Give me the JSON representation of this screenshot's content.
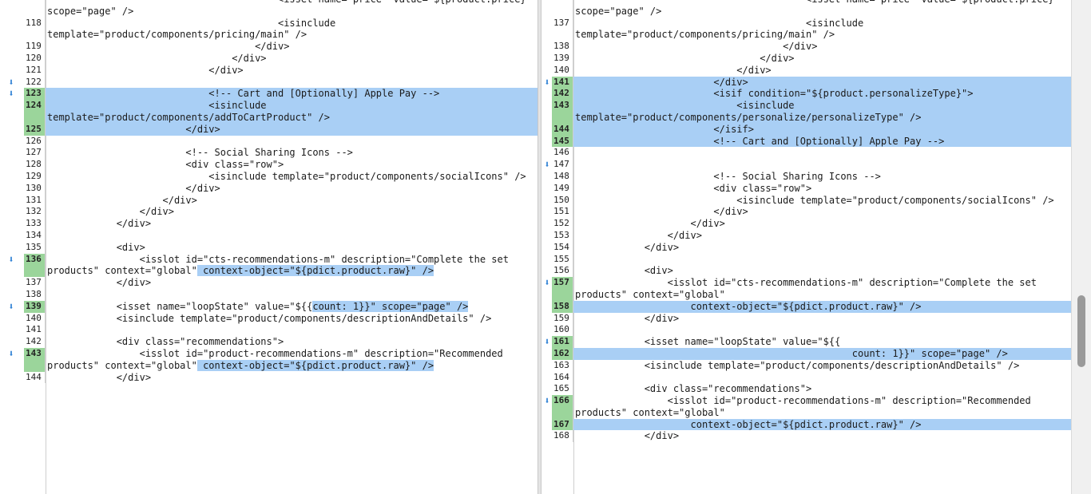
{
  "left": {
    "rows": [
      {
        "n": "",
        "t": "                                        <isset name=\"price\" value=\"${product.price}\""
      },
      {
        "n": "",
        "t": "scope=\"page\" />"
      },
      {
        "n": "118",
        "t": "                                        <isinclude"
      },
      {
        "n": "",
        "t": "template=\"product/components/pricing/main\" />"
      },
      {
        "n": "119",
        "t": "                                    </div>"
      },
      {
        "n": "120",
        "t": "                                </div>"
      },
      {
        "n": "121",
        "t": "                            </div>"
      },
      {
        "n": "",
        "t": "",
        "gap": true,
        "arrow": true
      },
      {
        "n": "",
        "t": "",
        "gap": true
      },
      {
        "n": "",
        "t": "",
        "gap": true
      },
      {
        "n": "",
        "t": "",
        "gap": true
      },
      {
        "n": "",
        "t": "",
        "gap": true
      },
      {
        "n": "",
        "t": "",
        "gap": true
      },
      {
        "n": "122",
        "t": ""
      },
      {
        "n": "123",
        "t": "                            <!-- Cart and [Optionally] Apple Pay -->",
        "hl": true,
        "arrow": true
      },
      {
        "n": "124",
        "t": "                            <isinclude",
        "hl": true
      },
      {
        "n": "",
        "t": "template=\"product/components/addToCartProduct\" />",
        "hl": true
      },
      {
        "n": "125",
        "t": "                        </div>",
        "hl": true
      },
      {
        "n": "126",
        "t": ""
      },
      {
        "n": "127",
        "t": "                        <!-- Social Sharing Icons -->"
      },
      {
        "n": "128",
        "t": "                        <div class=\"row\">"
      },
      {
        "n": "129",
        "t": "                            <isinclude template=\"product/components/socialIcons\" />"
      },
      {
        "n": "130",
        "t": "                        </div>"
      },
      {
        "n": "131",
        "t": "                    </div>"
      },
      {
        "n": "132",
        "t": "                </div>"
      },
      {
        "n": "133",
        "t": "            </div>"
      },
      {
        "n": "134",
        "t": ""
      },
      {
        "n": "135",
        "t": "            <div>"
      },
      {
        "n": "136",
        "t": "                <isslot id=\"cts-recommendations-m\" description=\"Complete the set",
        "chg": true,
        "arrow": true
      },
      {
        "n": "",
        "t": "products\" context=\"global\"",
        "hlpart": " context-object=\"${pdict.product.raw}\" />",
        "chg": true
      },
      {
        "n": "",
        "t": "",
        "blank": true
      },
      {
        "n": "137",
        "t": "            </div>"
      },
      {
        "n": "138",
        "t": ""
      },
      {
        "n": "139",
        "t": "            <isset name=\"loopState\" value=\"${{",
        "hlpart": "count: 1}}\" scope=\"page\" />",
        "chg": true,
        "arrow": true
      },
      {
        "n": "",
        "t": "",
        "blank": true
      },
      {
        "n": "140",
        "t": "            <isinclude template=\"product/components/descriptionAndDetails\" />"
      },
      {
        "n": "141",
        "t": ""
      },
      {
        "n": "142",
        "t": "            <div class=\"recommendations\">"
      },
      {
        "n": "143",
        "t": "                <isslot id=\"product-recommendations-m\" description=\"Recommended",
        "chg": true,
        "arrow": true
      },
      {
        "n": "",
        "t": "products\" context=\"global\"",
        "hlpart": " context-object=\"${pdict.product.raw}\" />",
        "chg": true
      },
      {
        "n": "",
        "t": "",
        "blank": true
      },
      {
        "n": "144",
        "t": "            </div>"
      }
    ]
  },
  "right": {
    "rows": [
      {
        "n": "",
        "t": "                                        <isset name=\"price\" value=\"${product.price}\""
      },
      {
        "n": "",
        "t": "scope=\"page\" />"
      },
      {
        "n": "137",
        "t": "                                        <isinclude"
      },
      {
        "n": "",
        "t": "template=\"product/components/pricing/main\" />"
      },
      {
        "n": "138",
        "t": "                                    </div>"
      },
      {
        "n": "139",
        "t": "                                </div>"
      },
      {
        "n": "140",
        "t": "                            </div>"
      },
      {
        "n": "141",
        "t": "                        </div>",
        "hl": true,
        "arrow": true
      },
      {
        "n": "142",
        "t": "                        <isif condition=\"${product.personalizeType}\">",
        "hl": true
      },
      {
        "n": "143",
        "t": "                            <isinclude",
        "hl": true
      },
      {
        "n": "",
        "t": "template=\"product/components/personalize/personalizeType\" />",
        "hl": true
      },
      {
        "n": "144",
        "t": "                        </isif>",
        "hl": true
      },
      {
        "n": "145",
        "t": "                        <!-- Cart and [Optionally] Apple Pay -->",
        "hl": true
      },
      {
        "n": "146",
        "t": ""
      },
      {
        "n": "",
        "t": "",
        "gap": true,
        "arrow": true
      },
      {
        "n": "",
        "t": "",
        "gap": true
      },
      {
        "n": "",
        "t": "",
        "gap": true
      },
      {
        "n": "",
        "t": "",
        "gap": true
      },
      {
        "n": "147",
        "t": ""
      },
      {
        "n": "148",
        "t": "                        <!-- Social Sharing Icons -->"
      },
      {
        "n": "149",
        "t": "                        <div class=\"row\">"
      },
      {
        "n": "150",
        "t": "                            <isinclude template=\"product/components/socialIcons\" />"
      },
      {
        "n": "151",
        "t": "                        </div>"
      },
      {
        "n": "152",
        "t": "                    </div>"
      },
      {
        "n": "153",
        "t": "                </div>"
      },
      {
        "n": "154",
        "t": "            </div>"
      },
      {
        "n": "155",
        "t": ""
      },
      {
        "n": "156",
        "t": "            <div>"
      },
      {
        "n": "157",
        "t": "                <isslot id=\"cts-recommendations-m\" description=\"Complete the set",
        "chg": true,
        "arrow": true
      },
      {
        "n": "",
        "t": "products\" context=\"global\"",
        "chg": true
      },
      {
        "n": "158",
        "t": "                    context-object=\"${pdict.product.raw}\" />",
        "hl": true,
        "chg": true
      },
      {
        "n": "159",
        "t": "            </div>"
      },
      {
        "n": "160",
        "t": ""
      },
      {
        "n": "161",
        "t": "            <isset name=\"loopState\" value=\"${{",
        "chg": true,
        "arrow": true
      },
      {
        "n": "162",
        "t": "                                                count: 1}}\" scope=\"page\" />",
        "hl": true,
        "chg": true
      },
      {
        "n": "163",
        "t": "            <isinclude template=\"product/components/descriptionAndDetails\" />"
      },
      {
        "n": "164",
        "t": ""
      },
      {
        "n": "165",
        "t": "            <div class=\"recommendations\">"
      },
      {
        "n": "166",
        "t": "                <isslot id=\"product-recommendations-m\" description=\"Recommended",
        "chg": true,
        "arrow": true
      },
      {
        "n": "",
        "t": "products\" context=\"global\"",
        "chg": true
      },
      {
        "n": "167",
        "t": "                    context-object=\"${pdict.product.raw}\" />",
        "hl": true,
        "chg": true
      },
      {
        "n": "168",
        "t": "            </div>"
      }
    ]
  },
  "icons": {
    "change_arrow": "arrow-down-icon"
  },
  "colors": {
    "highlight": "#a9cff5",
    "changed_gutter": "#9bd59b",
    "arrow": "#2b7fd4"
  }
}
